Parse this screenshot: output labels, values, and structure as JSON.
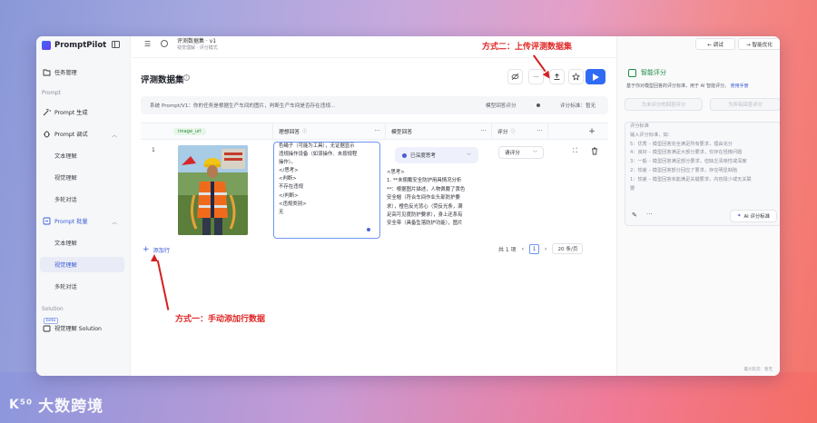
{
  "watermark": {
    "logo": "K⁵⁰",
    "text": "大数跨境"
  },
  "sidebar": {
    "brand": "PromptPilot",
    "task_mgmt": "任务管理",
    "section_prompt": "Prompt",
    "prompt_gen": "Prompt 生成",
    "prompt_debug": "Prompt 调试",
    "debug_text": "文本理解",
    "debug_visual": "视觉理解",
    "debug_multi": "多轮对话",
    "prompt_batch": "Prompt 批量",
    "batch_text": "文本理解",
    "batch_visual": "视觉理解",
    "batch_multi": "多轮对话",
    "section_solution": "Solution",
    "beta": "beta",
    "solution_visual": "视觉理解 Solution"
  },
  "topbar": {
    "title": "评测数据集 · v1",
    "breadcrumb": "视觉理解 · 评分模式"
  },
  "main": {
    "page_title": "评测数据集",
    "prompt_text": "系统 Prompt/V1：你的任务是根据生产车间的图片，判断生产车间是否存在违规...",
    "model_label": "模型回答评分",
    "score_label": "评分标准：暂无",
    "columns": {
      "image": "image_url",
      "ideal": "理想回答",
      "model": "模型回答",
      "score": "评分"
    },
    "row_index": "1",
    "ideal_lines": [
      "色绳子（可能为工具），无证据显示",
      "违规操作设备（如误操作、未按规程",
      "操作）。",
      "</思考>",
      "<判断>",
      "不存在违规",
      "</判断>",
      "<违规类别>",
      "无"
    ],
    "deep_think": "已深度思考",
    "model_lines": [
      "<思考>",
      "1. **未佩戴安全防护用具情况分析",
      "**：根据图片描述，人物佩戴了黄色",
      "安全帽（符合车间作业头部防护要",
      "求），橙色反光背心（荧反光条，满",
      "足高可见度防护要求），身上还系有",
      "安全带（具备坠落防护功能），图片"
    ],
    "score_select": "请评分",
    "add_row": "添加行",
    "pagination": {
      "total": "共 1 项",
      "current": "1",
      "page_size": "20 条/页"
    }
  },
  "right_panel": {
    "debug_btn": "← 调试",
    "optimize_btn": "→ 智能优化",
    "title": "智能评分",
    "desc": "基于你对模型回答的评分标准，用于 AI 智能评分。",
    "desc_link": "使用手册",
    "btn_gen_answer": "为未评分的回答评分",
    "btn_gen_all": "为所有回答评分",
    "criteria_lines": [
      "评分标准",
      "输入评分标准，如：",
      "5：优秀 – 模型回答完全满足所有要求，理由充分",
      "4：良好 – 模型回答满足大部分要求，仅存在轻微问题",
      "3：一般 – 模型回答满足部分要求，但缺乏清晰性或深度",
      "2：较差 – 模型回答部分回应了要求，存在明显缺陷",
      "1：较差 – 模型回答未能满足关键要求，内容极少或无关联",
      "要"
    ],
    "ai_btn": "AI 评分标准",
    "footer": "最大轮次：暂无"
  },
  "annotations": {
    "method1": "方式一：手动添加行数据",
    "method2": "方式二：上传评测数据集"
  },
  "colors": {
    "accent": "#2f6bf5",
    "annotation_red": "#e02626",
    "green": "#1e8a4a"
  }
}
